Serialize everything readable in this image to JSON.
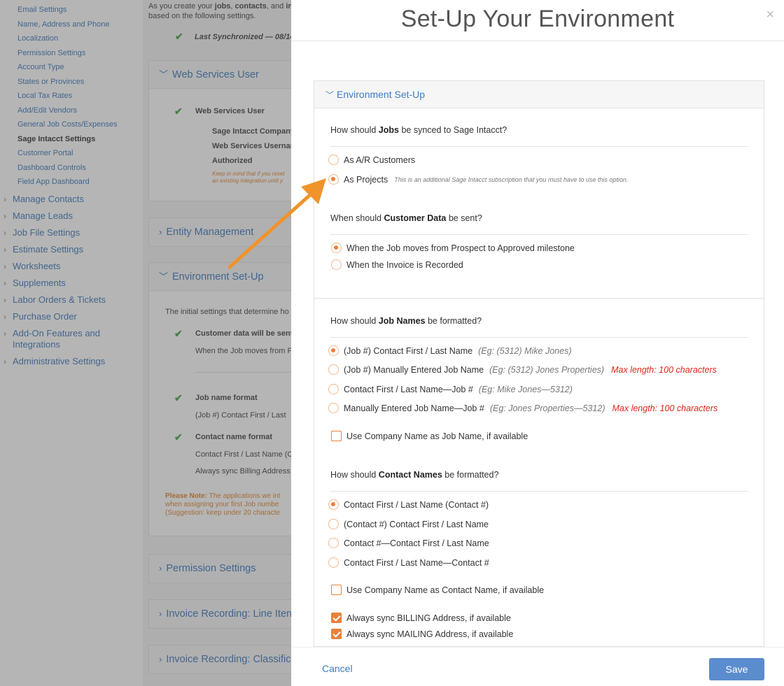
{
  "sidebar": {
    "sub_items": [
      "Email Settings",
      "Name, Address and Phone",
      "Localization",
      "Permission Settings",
      "Account Type",
      "States or Provinces",
      "Local Tax Rates",
      "Add/Edit Vendors",
      "General Job Costs/Expenses",
      "Sage Intacct Settings",
      "Customer Portal",
      "Dashboard Controls",
      "Field App Dashboard"
    ],
    "active_sub_index": 9,
    "top_items": [
      "Manage Contacts",
      "Manage Leads",
      "Job File Settings",
      "Estimate Settings",
      "Worksheets",
      "Supplements",
      "Labor Orders & Tickets",
      "Purchase Order",
      "Add-On Features and Integrations",
      "Administrative Settings"
    ]
  },
  "center": {
    "intro_pre": "As you create your ",
    "intro_b1": "jobs",
    "intro_mid1": ", ",
    "intro_b2": "contacts",
    "intro_mid2": ", and ",
    "intro_b3": "inv",
    "intro_post": "based on the following settings.",
    "last_sync": "Last Synchronized — 08/14/",
    "web_services_panel": {
      "title": "Web Services User",
      "label": "Web Services User",
      "rows": [
        "Sage Intacct Company",
        "Web Services Usernam",
        "Authorized"
      ],
      "note_line1": "Keep in mind that if you reset",
      "note_line2": "an existing integration until y"
    },
    "entity_management": "Entity Management",
    "env_panel": {
      "title": "Environment Set-Up",
      "intro": "The initial settings that determine ho",
      "customer_label": "Customer data will be sent",
      "customer_value": "When the Job moves from P",
      "job_label": "Job name format",
      "job_value": "(Job #) Contact First / Last",
      "contact_label": "Contact name format",
      "contact_value": "Contact First / Last Name (C",
      "billing_value": "Always sync Billing Address",
      "please_note": "Please Note:",
      "note_l1": " The applications we int",
      "note_l2": "when assigning your first Job numbe",
      "note_l3": "(Suggestion: keep under 20 characte"
    },
    "permission_settings": "Permission Settings",
    "invoice_line": "Invoice Recording: Line Iten",
    "invoice_class": "Invoice Recording: Classific"
  },
  "modal": {
    "title": "Set-Up Your Environment",
    "close_glyph": "×",
    "section_title": "Environment Set-Up",
    "q1_pre": "How should ",
    "q1_b": "Jobs",
    "q1_post": " be synced to Sage Intacct?",
    "q1_opt1": "As A/R Customers",
    "q1_opt2": "As Projects",
    "q1_opt2_note": "This is an additional Sage Intacct subscription that you must have to use this option.",
    "q2_pre": "When should ",
    "q2_b": "Customer Data",
    "q2_post": " be sent?",
    "q2_opt1": "When the Job moves from Prospect to Approved milestone",
    "q2_opt2": "When the Invoice is Recorded",
    "q3_pre": "How should ",
    "q3_b": "Job Names",
    "q3_post": " be formatted?",
    "q3_opts": [
      {
        "label": "(Job #) Contact First / Last Name",
        "eg": "(Eg: (5312) Mike Jones)",
        "max": ""
      },
      {
        "label": "(Job #) Manually Entered Job Name",
        "eg": "(Eg: (5312) Jones Properties)",
        "max": "Max length: 100 characters"
      },
      {
        "label": "Contact First / Last Name—Job #",
        "eg": "(Eg: Mike Jones—5312)",
        "max": ""
      },
      {
        "label": "Manually Entered Job Name—Job #",
        "eg": "(Eg: Jones Properties—5312)",
        "max": "Max length: 100 characters"
      }
    ],
    "q3_checkbox": "Use Company Name as Job Name, if available",
    "q4_pre": "How should ",
    "q4_b": "Contact Names",
    "q4_post": " be formatted?",
    "q4_opts": [
      "Contact First / Last Name (Contact #)",
      "(Contact #) Contact First / Last Name",
      "Contact #—Contact First / Last Name",
      "Contact First / Last Name—Contact #"
    ],
    "q4_checkbox": "Use Company Name as Contact Name, if available",
    "billing_checkbox": "Always sync BILLING Address, if available",
    "mailing_checkbox": "Always sync MAILING Address, if available",
    "cancel_label": "Cancel",
    "save_label": "Save",
    "state": {
      "q1_selected": 1,
      "q2_selected": 0,
      "q3_selected": 0,
      "q4_selected": 0,
      "q3_checkbox": false,
      "q4_checkbox": false,
      "billing": true,
      "mailing": true
    }
  },
  "colors": {
    "accent_orange": "#e8813a",
    "link_blue": "#3d7dc4",
    "save_button": "#5b8ccd",
    "check_green": "#3a9a3a",
    "error_red": "#e0251b"
  }
}
